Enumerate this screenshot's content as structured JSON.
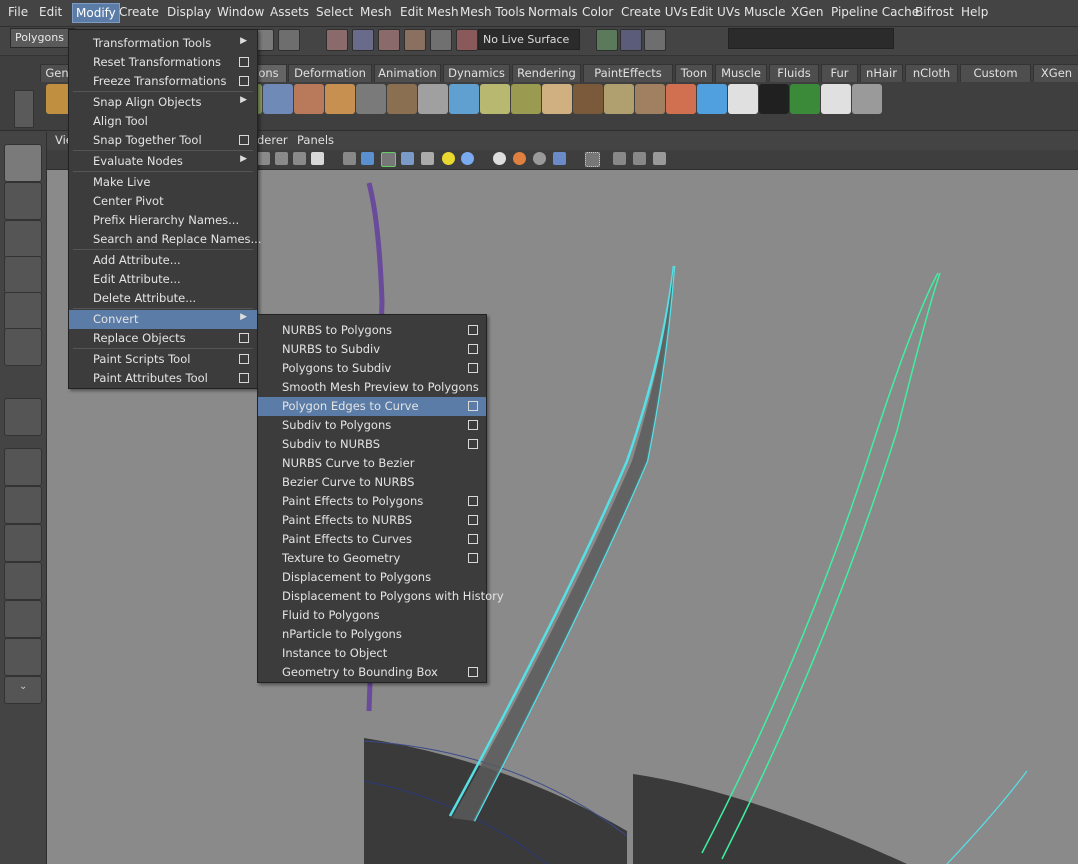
{
  "menubar": {
    "items": [
      "File",
      "Edit",
      "Modify",
      "Create",
      "Display",
      "Window",
      "Assets",
      "Select",
      "Mesh",
      "Edit Mesh",
      "Mesh Tools",
      "Normals",
      "Color",
      "Create UVs",
      "Edit UVs",
      "Muscle",
      "XGen",
      "Pipeline Cache",
      "Bifrost",
      "Help"
    ],
    "active": "Modify"
  },
  "statusline": {
    "mode": "Polygons",
    "live_surface": "No Live Surface"
  },
  "shelf": {
    "tabs": [
      "Gen",
      "ons",
      "Deformation",
      "Animation",
      "Dynamics",
      "Rendering",
      "PaintEffects",
      "Toon",
      "Muscle",
      "Fluids",
      "Fur",
      "nHair",
      "nCloth",
      "Custom",
      "XGen"
    ],
    "selected_tab": "ons"
  },
  "viewport": {
    "menu": [
      "Vie",
      "derer",
      "Panels"
    ]
  },
  "modify_menu": {
    "items": [
      {
        "label": "Transformation Tools",
        "submenu": true
      },
      {
        "label": "Reset Transformations",
        "option": true
      },
      {
        "label": "Freeze Transformations",
        "option": true
      },
      {
        "label": "Snap Align Objects",
        "submenu": true
      },
      {
        "label": "Align Tool"
      },
      {
        "label": "Snap Together Tool",
        "option": true
      },
      {
        "label": "Evaluate Nodes",
        "submenu": true
      },
      {
        "label": "Make Live"
      },
      {
        "label": "Center Pivot"
      },
      {
        "label": "Prefix Hierarchy Names..."
      },
      {
        "label": "Search and Replace Names..."
      },
      {
        "label": "Add Attribute..."
      },
      {
        "label": "Edit Attribute..."
      },
      {
        "label": "Delete Attribute..."
      },
      {
        "label": "Convert",
        "submenu": true,
        "highlighted": true
      },
      {
        "label": "Replace Objects",
        "option": true
      },
      {
        "label": "Paint Scripts Tool",
        "option": true
      },
      {
        "label": "Paint Attributes Tool",
        "option": true
      }
    ]
  },
  "convert_menu": {
    "items": [
      {
        "label": "NURBS to Polygons",
        "option": true
      },
      {
        "label": "NURBS to Subdiv",
        "option": true
      },
      {
        "label": "Polygons to Subdiv",
        "option": true
      },
      {
        "label": "Smooth Mesh Preview to Polygons"
      },
      {
        "label": "Polygon Edges to Curve",
        "option": true,
        "highlighted": true
      },
      {
        "label": "Subdiv to Polygons",
        "option": true
      },
      {
        "label": "Subdiv to NURBS",
        "option": true
      },
      {
        "label": "NURBS Curve to Bezier"
      },
      {
        "label": "Bezier Curve to NURBS"
      },
      {
        "label": "Paint Effects to Polygons",
        "option": true
      },
      {
        "label": "Paint Effects to NURBS",
        "option": true
      },
      {
        "label": "Paint Effects to Curves",
        "option": true
      },
      {
        "label": "Texture to Geometry",
        "option": true
      },
      {
        "label": "Displacement to Polygons"
      },
      {
        "label": "Displacement to Polygons with History"
      },
      {
        "label": "Fluid to Polygons"
      },
      {
        "label": "nParticle to Polygons"
      },
      {
        "label": "Instance to Object"
      },
      {
        "label": "Geometry to Bounding Box",
        "option": true
      }
    ]
  },
  "colors": {
    "highlight": "#5a7ca6",
    "menu_bg": "#3c3c3c",
    "viewport_bg": "#8a8a8a",
    "wire_cyan": "#55e0e6",
    "curve_green": "#3ef0a0"
  }
}
